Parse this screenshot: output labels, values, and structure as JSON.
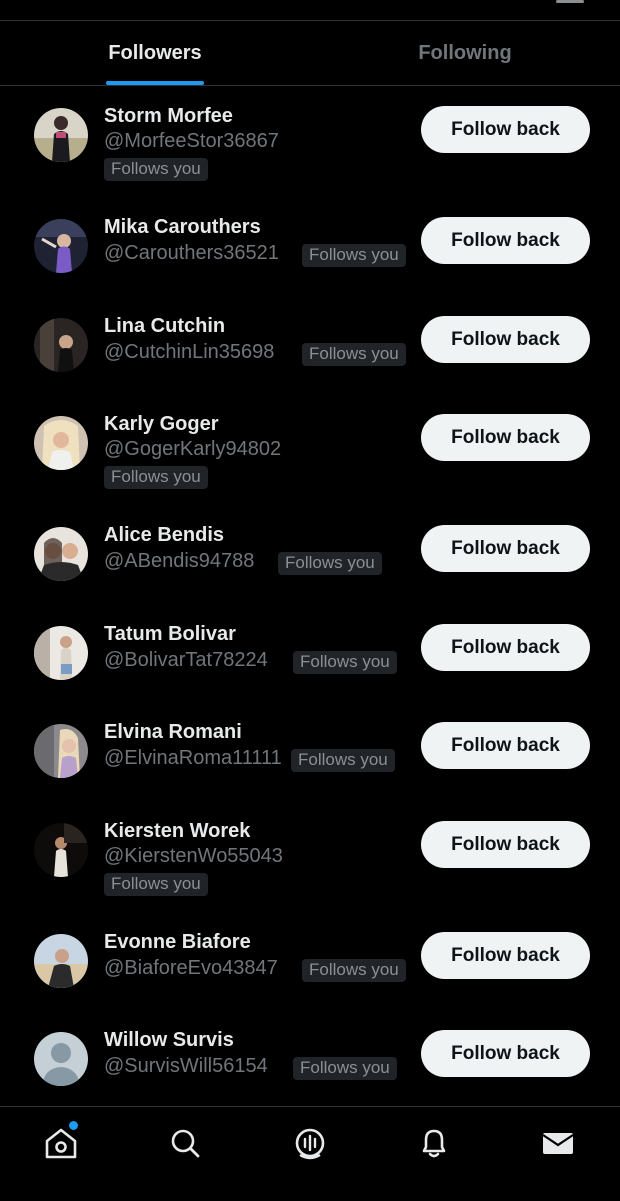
{
  "tabs": {
    "followers": "Followers",
    "following": "Following"
  },
  "follow_button_label": "Follow back",
  "follows_you_label": "Follows you",
  "accent_color": "#1d9bf0",
  "users": [
    {
      "name": "Storm Morfee",
      "handle": "@MorfeeStor36867"
    },
    {
      "name": "Mika Carouthers",
      "handle": "@Carouthers36521"
    },
    {
      "name": "Lina Cutchin",
      "handle": "@CutchinLin35698"
    },
    {
      "name": "Karly Goger",
      "handle": "@GogerKarly94802"
    },
    {
      "name": "Alice Bendis",
      "handle": "@ABendis94788"
    },
    {
      "name": "Tatum Bolivar",
      "handle": "@BolivarTat78224"
    },
    {
      "name": "Elvina Romani",
      "handle": "@ElvinaRoma11111"
    },
    {
      "name": "Kiersten Worek",
      "handle": "@KierstenWo55043"
    },
    {
      "name": "Evonne Biafore",
      "handle": "@BiaforeEvo43847"
    },
    {
      "name": "Willow Survis",
      "handle": "@SurvisWill56154"
    }
  ],
  "bottom_nav": [
    {
      "icon": "home-icon",
      "has_notification_dot": true
    },
    {
      "icon": "search-icon"
    },
    {
      "icon": "communities-icon"
    },
    {
      "icon": "notifications-icon"
    },
    {
      "icon": "messages-icon"
    }
  ]
}
